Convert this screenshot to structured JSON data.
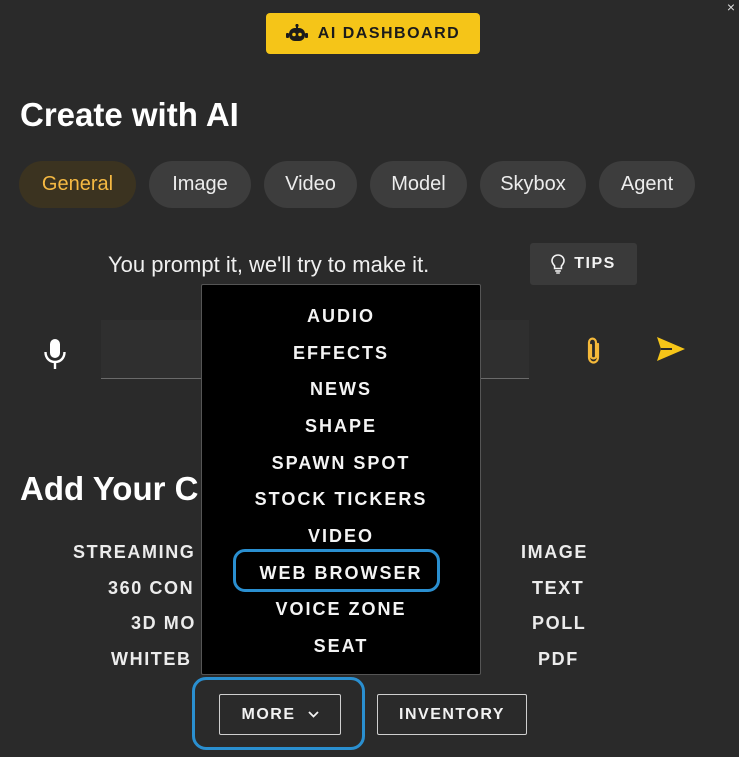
{
  "window": {
    "close_glyph": "×"
  },
  "header": {
    "ai_dashboard_label": "AI DASHBOARD",
    "icon": "robot-icon"
  },
  "create": {
    "title": "Create with AI",
    "tabs": [
      {
        "label": "General",
        "active": true
      },
      {
        "label": "Image",
        "active": false
      },
      {
        "label": "Video",
        "active": false
      },
      {
        "label": "Model",
        "active": false
      },
      {
        "label": "Skybox",
        "active": false
      },
      {
        "label": "Agent",
        "active": false
      }
    ],
    "prompt_text": "You prompt it, we'll try to make it.",
    "tips_label": "TIPS",
    "prompt_value": ""
  },
  "add_content": {
    "title_visible": "Add Your C",
    "left_column": [
      "STREAMING",
      "360 CON",
      "3D MO",
      "WHITEB"
    ],
    "right_column": [
      "IMAGE",
      "TEXT",
      "POLL",
      "PDF"
    ]
  },
  "more_menu": {
    "items": [
      "AUDIO",
      "EFFECTS",
      "NEWS",
      "SHAPE",
      "SPAWN SPOT",
      "STOCK TICKERS",
      "VIDEO",
      "WEB BROWSER",
      "VOICE ZONE",
      "SEAT"
    ],
    "highlighted": "WEB BROWSER"
  },
  "footer": {
    "more_label": "MORE",
    "inventory_label": "INVENTORY"
  },
  "colors": {
    "background": "#2a2a2a",
    "accent_yellow": "#f5c518",
    "active_tab_text": "#f5b942",
    "highlight_blue": "#2a8fd0",
    "menu_bg": "#000000"
  }
}
